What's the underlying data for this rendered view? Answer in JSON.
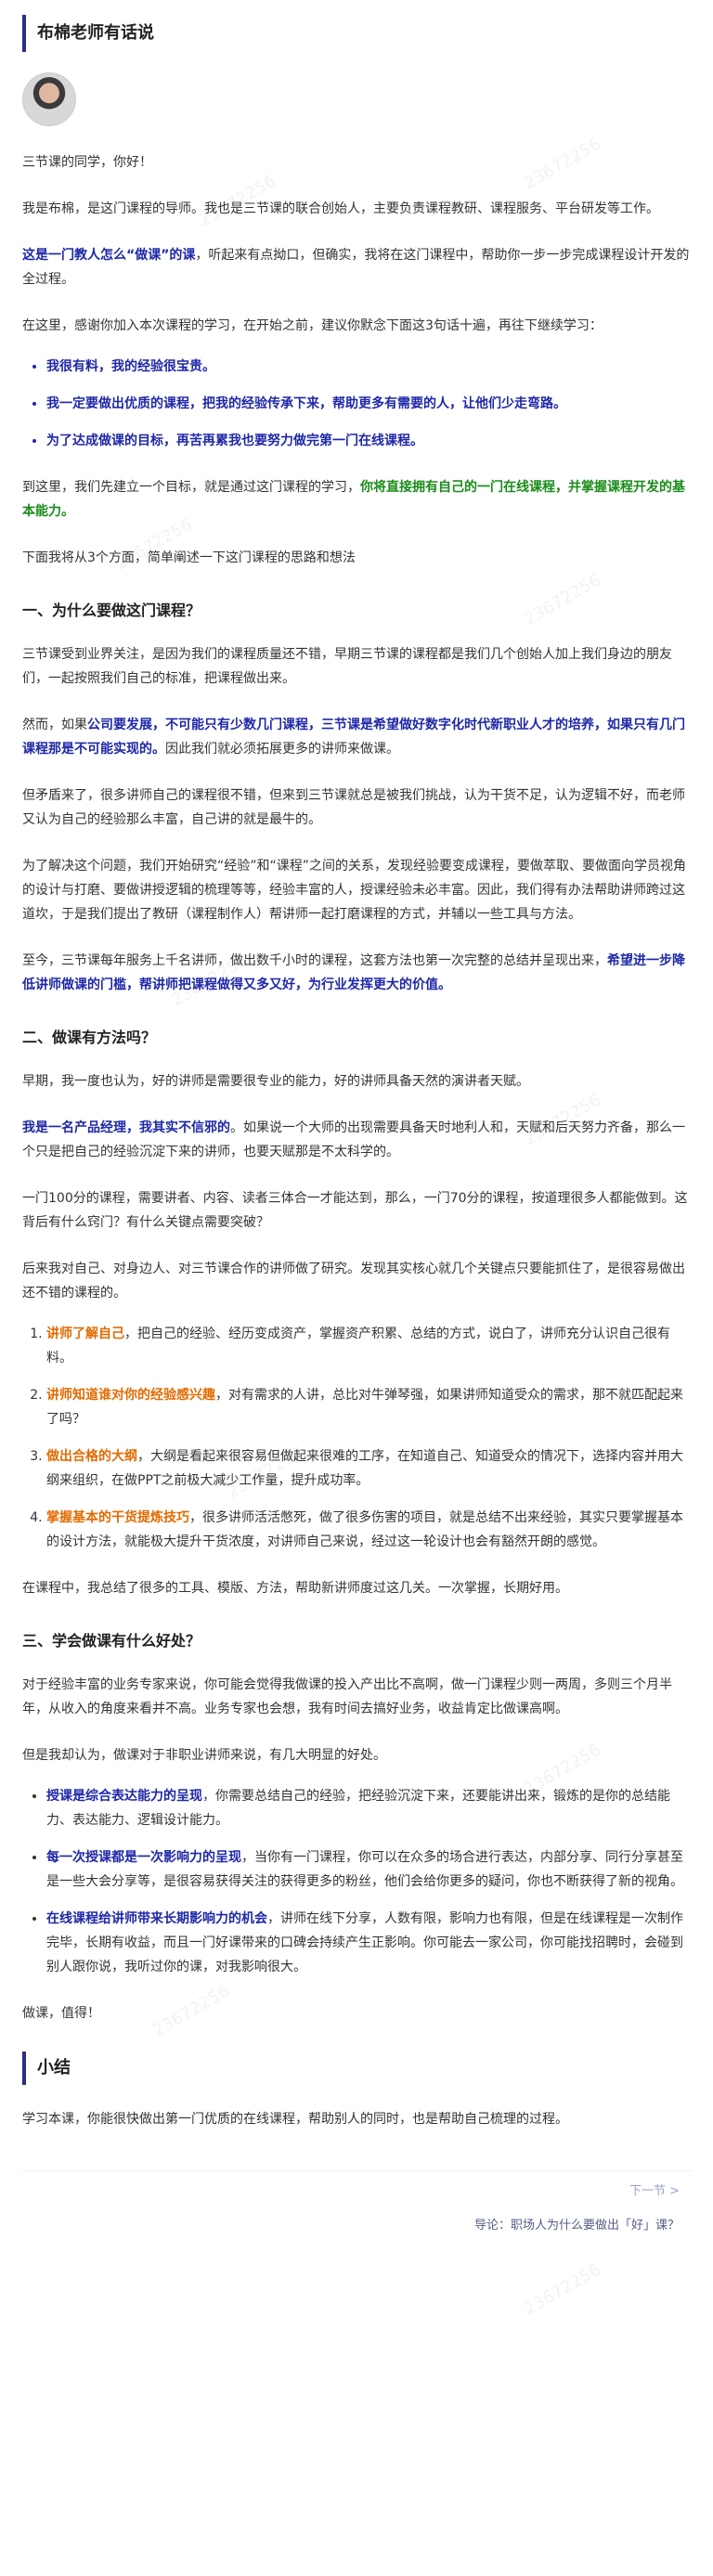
{
  "header": {
    "title": "布棉老师有话说"
  },
  "watermark": "23672256",
  "intro": {
    "greeting": "三节课的同学，你好！",
    "p1": "我是布棉，是这门课程的导师。我也是三节课的联合创始人，主要负责课程教研、课程服务、平台研发等工作。",
    "p2_bold": "这是一门教人怎么“做课”的课",
    "p2_rest": "，听起来有点拗口，但确实，我将在这门课程中，帮助你一步一步完成课程设计开发的全过程。",
    "p3": "在这里，感谢你加入本次课程的学习，在开始之前，建议你默念下面这3句话十遍，再往下继续学习：",
    "mantras": [
      "我很有料，我的经验很宝贵。",
      "我一定要做出优质的课程，把我的经验传承下来，帮助更多有需要的人，让他们少走弯路。",
      "为了达成做课的目标，再苦再累我也要努力做完第一门在线课程。"
    ],
    "p4_a": "到这里，我们先建立一个目标，就是通过这门课程的学习，",
    "p4_green": "你将直接拥有自己的一门在线课程，并掌握课程开发的基本能力。",
    "p5": "下面我将从3个方面，简单阐述一下这门课程的思路和想法"
  },
  "s1": {
    "title": "一、为什么要做这门课程？",
    "p1": "三节课受到业界关注，是因为我们的课程质量还不错，早期三节课的课程都是我们几个创始人加上我们身边的朋友们，一起按照我们自己的标准，把课程做出来。",
    "p2_a": "然而，如果",
    "p2_b": "公司要发展，不可能只有少数几门课程，三节课是希望做好数字化时代新职业人才的培养，如果只有几门课程那是不可能实现的。",
    "p2_c": "因此我们就必须拓展更多的讲师来做课。",
    "p3": "但矛盾来了，很多讲师自己的课程很不错，但来到三节课就总是被我们挑战，认为干货不足，认为逻辑不好，而老师又认为自己的经验那么丰富，自己讲的就是最牛的。",
    "p4": "为了解决这个问题，我们开始研究“经验”和“课程”之间的关系，发现经验要变成课程，要做萃取、要做面向学员视角的设计与打磨、要做讲授逻辑的梳理等等，经验丰富的人，授课经验未必丰富。因此，我们得有办法帮助讲师跨过这道坎，于是我们提出了教研（课程制作人）帮讲师一起打磨课程的方式，并辅以一些工具与方法。",
    "p5_a": "至今，三节课每年服务上千名讲师，做出数千小时的课程，这套方法也第一次完整的总结并呈现出来，",
    "p5_b": "希望进一步降低讲师做课的门槛，帮讲师把课程做得又多又好，为行业发挥更大的价值。"
  },
  "s2": {
    "title": "二、做课有方法吗？",
    "p1": "早期，我一度也认为，好的讲师是需要很专业的能力，好的讲师具备天然的演讲者天赋。",
    "p2_b": "我是一名产品经理，我其实不信邪的",
    "p2_rest": "。如果说一个大师的出现需要具备天时地利人和，天赋和后天努力齐备，那么一个只是把自己的经验沉淀下来的讲师，也要天赋那是不太科学的。",
    "p3": "一门100分的课程，需要讲者、内容、读者三体合一才能达到，那么，一门70分的课程，按道理很多人都能做到。这背后有什么窍门？有什么关键点需要突破？",
    "p4": "后来我对自己、对身边人、对三节课合作的讲师做了研究。发现其实核心就几个关键点只要能抓住了，是很容易做出还不错的课程的。",
    "items": [
      {
        "k": "讲师了解自己",
        "t": "，把自己的经验、经历变成资产，掌握资产积累、总结的方式，说白了，讲师充分认识自己很有料。"
      },
      {
        "k": "讲师知道谁对你的经验感兴趣",
        "t": "，对有需求的人讲，总比对牛弹琴强，如果讲师知道受众的需求，那不就匹配起来了吗？"
      },
      {
        "k": "做出合格的大纲",
        "t": "，大纲是看起来很容易但做起来很难的工序，在知道自己、知道受众的情况下，选择内容并用大纲来组织，在做PPT之前极大减少工作量，提升成功率。"
      },
      {
        "k": "掌握基本的干货提炼技巧",
        "t": "，很多讲师活活憋死，做了很多伤害的项目，就是总结不出来经验，其实只要掌握基本的设计方法，就能极大提升干货浓度，对讲师自己来说，经过这一轮设计也会有豁然开朗的感觉。"
      }
    ],
    "p5": "在课程中，我总结了很多的工具、模版、方法，帮助新讲师度过这几关。一次掌握，长期好用。"
  },
  "s3": {
    "title": "三、学会做课有什么好处？",
    "p1": "对于经验丰富的业务专家来说，你可能会觉得我做课的投入产出比不高啊，做一门课程少则一两周，多则三个月半年，从收入的角度来看并不高。业务专家也会想，我有时间去搞好业务，收益肯定比做课高啊。",
    "p2": "但是我却认为，做课对于非职业讲师来说，有几大明显的好处。",
    "items": [
      {
        "k": "授课是综合表达能力的呈现",
        "t": "，你需要总结自己的经验，把经验沉淀下来，还要能讲出来，锻炼的是你的总结能力、表达能力、逻辑设计能力。"
      },
      {
        "k": "每一次授课都是一次影响力的呈现",
        "t": "，当你有一门课程，你可以在众多的场合进行表达，内部分享、同行分享甚至是一些大会分享等，是很容易获得关注的获得更多的粉丝，他们会给你更多的疑问，你也不断获得了新的视角。"
      },
      {
        "k": "在线课程给讲师带来长期影响力的机会",
        "t": "，讲师在线下分享，人数有限，影响力也有限，但是在线课程是一次制作完毕，长期有收益，而且一门好课带来的口碑会持续产生正影响。你可能去一家公司，你可能找招聘时，会碰到别人跟你说，我听过你的课，对我影响很大。"
      }
    ],
    "p3": "做课，值得！"
  },
  "summary": {
    "title": "小结",
    "p1": "学习本课，你能很快做出第一门优质的在线课程，帮助别人的同时，也是帮助自己梳理的过程。"
  },
  "nav": {
    "next_label": "下一节 >",
    "next_link": "导论：职场人为什么要做出「好」课？"
  }
}
